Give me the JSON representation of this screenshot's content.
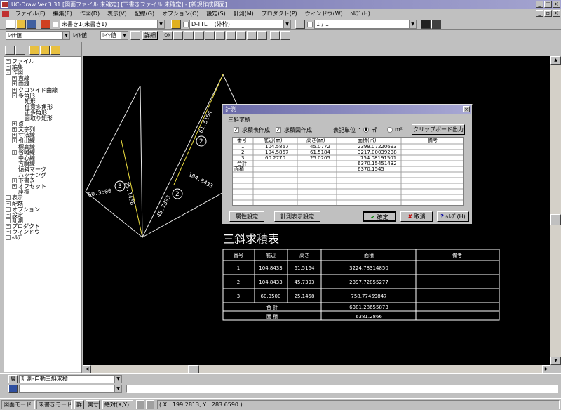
{
  "window": {
    "title": "UC-Draw Ver.3.31 [図面ファイル:未確定] [下書きファイル:未確定] - [新規作成図面]"
  },
  "menu": [
    "ファイル(F)",
    "編集(E)",
    "作図(D)",
    "表示(V)",
    "配線(G)",
    "オプション(O)",
    "設定(S)",
    "計測(M)",
    "プロダクト(P)",
    "ウィンドウ(W)",
    "ﾍﾙﾌﾟ(H)"
  ],
  "toolbar": {
    "layer_combo": "未書き1(未書き1)",
    "linetype_combo": "D-TTL",
    "linetype_note": "(外枠)",
    "page_combo": "1 / 1",
    "style1": "ﾚｲﾔ値",
    "style2_label": "ﾚｲﾔ値",
    "style3": "ﾚｲﾔ値",
    "detail_btn": "詳細",
    "on_label": "ON"
  },
  "tree": [
    {
      "label": "ファイル",
      "box": "+",
      "indent": 0
    },
    {
      "label": "編集",
      "box": "+",
      "indent": 0
    },
    {
      "label": "作図",
      "box": "-",
      "indent": 0
    },
    {
      "label": "直線",
      "box": "+",
      "indent": 1
    },
    {
      "label": "曲線",
      "box": "+",
      "indent": 1
    },
    {
      "label": "クロソイド曲線",
      "box": "+",
      "indent": 1
    },
    {
      "label": "多角形",
      "box": "-",
      "indent": 1
    },
    {
      "label": "矩形",
      "box": "",
      "indent": 2
    },
    {
      "label": "任意多角形",
      "box": "",
      "indent": 2
    },
    {
      "label": "正多角形",
      "box": "",
      "indent": 2
    },
    {
      "label": "面取り矩形",
      "box": "",
      "indent": 2
    },
    {
      "label": "点",
      "box": "+",
      "indent": 1
    },
    {
      "label": "文字列",
      "box": "+",
      "indent": 1
    },
    {
      "label": "寸法線",
      "box": "+",
      "indent": 1
    },
    {
      "label": "引出線",
      "box": "+",
      "indent": 1
    },
    {
      "label": "標高線",
      "box": "",
      "indent": 1
    },
    {
      "label": "省略線",
      "box": "+",
      "indent": 1
    },
    {
      "label": "中心線",
      "box": "",
      "indent": 1
    },
    {
      "label": "方眼線",
      "box": "",
      "indent": 1
    },
    {
      "label": "傾斜マーク",
      "box": "",
      "indent": 1
    },
    {
      "label": "ハッチング",
      "box": "",
      "indent": 1
    },
    {
      "label": "下書き",
      "box": "+",
      "indent": 1
    },
    {
      "label": "オフセット",
      "box": "+",
      "indent": 1
    },
    {
      "label": "座標",
      "box": "",
      "indent": 1
    },
    {
      "label": "表示",
      "box": "+",
      "indent": 0
    },
    {
      "label": "配筋",
      "box": "+",
      "indent": 0
    },
    {
      "label": "オプション",
      "box": "+",
      "indent": 0
    },
    {
      "label": "設定",
      "box": "+",
      "indent": 0
    },
    {
      "label": "計測",
      "box": "+",
      "indent": 0
    },
    {
      "label": "プロダクト",
      "box": "+",
      "indent": 0
    },
    {
      "label": "ウィンドウ",
      "box": "+",
      "indent": 0
    },
    {
      "label": "ﾍﾙﾌﾟ",
      "box": "+",
      "indent": 0
    }
  ],
  "drawing": {
    "labels": [
      "61.5164",
      "104.8433",
      "45.7393",
      "60.3500",
      "25.1458"
    ],
    "circle_labels": [
      "3",
      "2",
      "1"
    ]
  },
  "dialog": {
    "title": "計測",
    "subtitle": "三斜求積",
    "chk1": "求積表作成",
    "chk2": "求積図作成",
    "unit_label": "表記単位",
    "unit_opt1": "㎡",
    "unit_opt2": "m²",
    "clipboard_btn": "クリップボード出力",
    "headers": [
      "番号",
      "底辺(㎜)",
      "高さ(㎜)",
      "面積(㎡)",
      "備考"
    ],
    "rows": [
      [
        "1",
        "104.5867",
        "45.0772",
        "2399.07220693",
        ""
      ],
      [
        "2",
        "104.5867",
        "61.5184",
        "3217.00039238",
        ""
      ],
      [
        "3",
        "60.2770",
        "25.0205",
        "754.08191501",
        ""
      ],
      [
        "合計",
        "",
        "",
        "6370.15451432",
        ""
      ],
      [
        "面積",
        "",
        "",
        "6370.1545",
        ""
      ]
    ],
    "attr_btn": "属性設定",
    "measure_btn": "計測表示設定",
    "ok_btn": "確定",
    "cancel_btn": "取消",
    "help_btn": "ﾍﾙﾌﾟ(H)"
  },
  "table": {
    "title": "三斜求積表",
    "headers": [
      "番号",
      "底辺",
      "高さ",
      "面積",
      "備考"
    ],
    "rows": [
      [
        "1",
        "104.8433",
        "61.5164",
        "3224.78314850",
        ""
      ],
      [
        "2",
        "104.8433",
        "45.7393",
        "2397.72855277",
        ""
      ],
      [
        "3",
        "60.3500",
        "25.1458",
        "758.77459847",
        ""
      ]
    ],
    "total_label": "合  計",
    "total_value": "6381.28655873",
    "area_label": "面  積",
    "area_value": "6381.2866"
  },
  "bottom": {
    "layer_tag": "層",
    "command_combo": "計測-自動三斜求積",
    "input_value": ""
  },
  "status": {
    "mode1": "図面モード",
    "mode2": "未書きモード",
    "b1": "詳",
    "b2": "実寸",
    "b3": "絶対(X,Y)",
    "coords": "( X : 199.2813, Y : 283.6590 )"
  }
}
